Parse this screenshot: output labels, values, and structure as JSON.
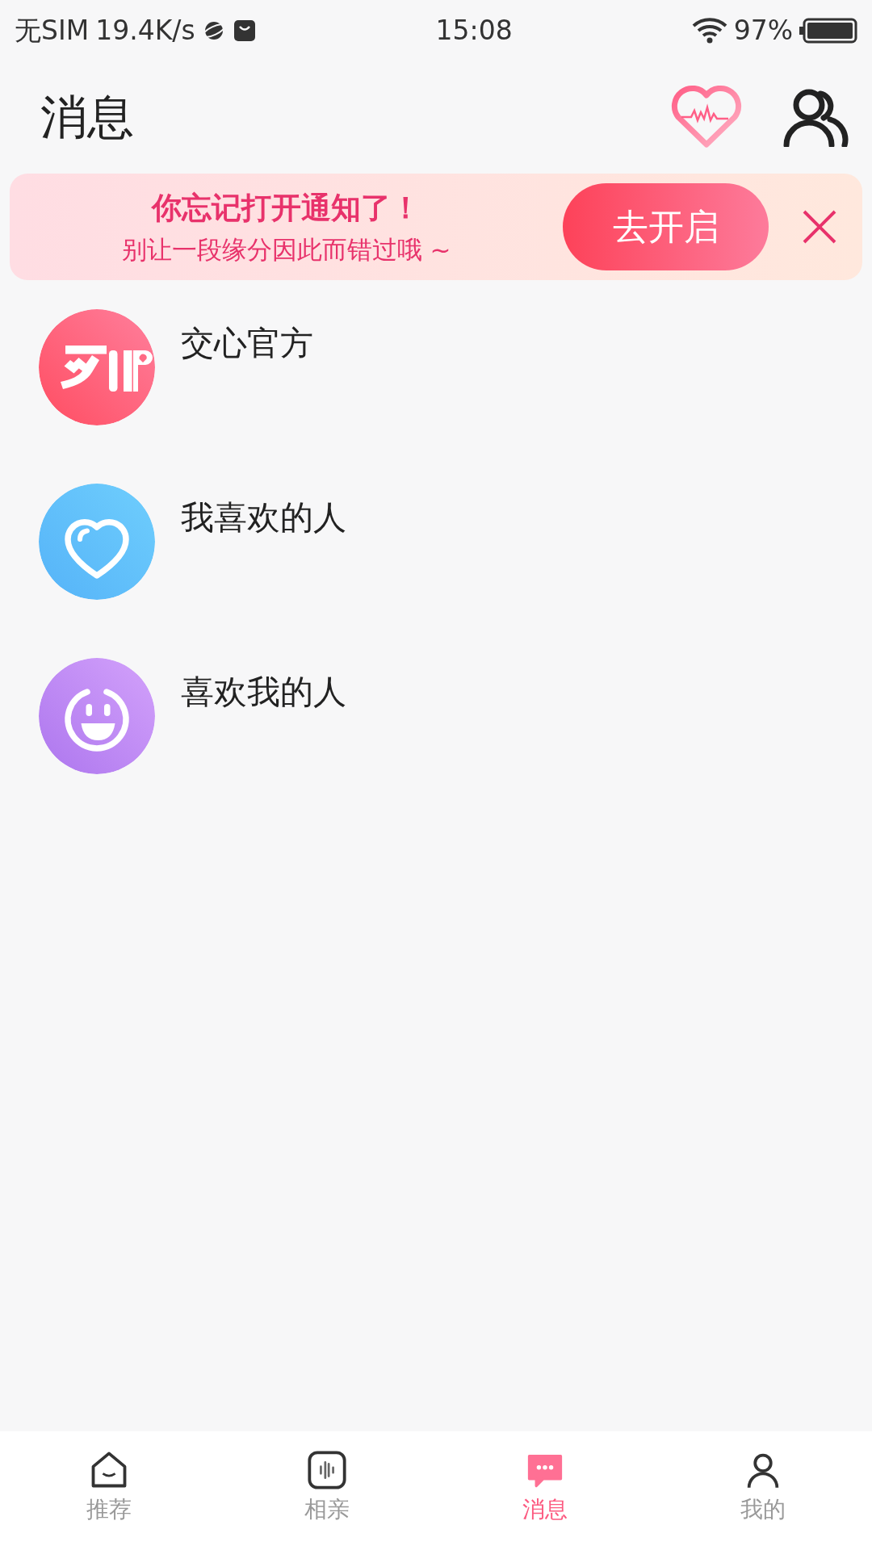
{
  "status_bar": {
    "carrier": "无SIM",
    "speed": "19.4K/s",
    "time": "15:08",
    "battery": "97%"
  },
  "header": {
    "title": "消息"
  },
  "notice": {
    "title": "你忘记打开通知了！",
    "subtitle": "别让一段缘分因此而错过哦 ~",
    "button": "去开启"
  },
  "conversations": [
    {
      "kind": "official",
      "name": "交心官方"
    },
    {
      "kind": "liked",
      "name": "我喜欢的人"
    },
    {
      "kind": "likers",
      "name": "喜欢我的人"
    }
  ],
  "tab_bar": [
    {
      "kind": "home",
      "label": "推荐",
      "selected": false
    },
    {
      "kind": "voice",
      "label": "相亲",
      "selected": false
    },
    {
      "kind": "chat",
      "label": "消息",
      "selected": true
    },
    {
      "kind": "me",
      "label": "我的",
      "selected": false
    }
  ]
}
